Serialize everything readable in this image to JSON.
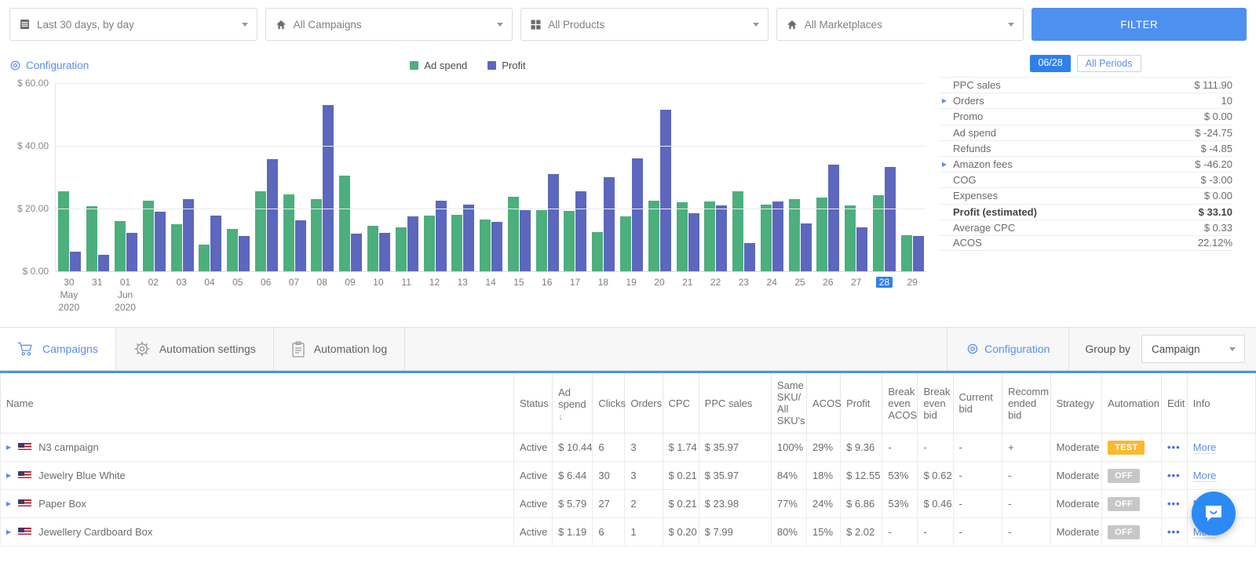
{
  "filters": {
    "date_range": {
      "label": "Last 30 days, by day",
      "icon": "calendar-icon"
    },
    "campaigns": {
      "label": "All Campaigns",
      "icon": "home-icon"
    },
    "products": {
      "label": "All Products",
      "icon": "grid-icon"
    },
    "marketplaces": {
      "label": "All Marketplaces",
      "icon": "home-icon"
    },
    "filter_button": "FILTER"
  },
  "chart_panel": {
    "configuration_label": "Configuration",
    "legend": [
      {
        "name": "Ad spend",
        "color": "#4caf7d"
      },
      {
        "name": "Profit",
        "color": "#5c67bd"
      }
    ]
  },
  "chart_data": {
    "type": "bar",
    "title": "",
    "xlabel": "",
    "ylabel": "",
    "ylim": [
      0,
      60
    ],
    "ytick_labels": [
      "$ 0.00",
      "$ 20.00",
      "$ 40.00",
      "$ 60.00"
    ],
    "yticks": [
      0,
      20,
      40,
      60
    ],
    "grid": true,
    "legend_position": "top-center",
    "selected_category": "28",
    "categories": [
      "30",
      "31",
      "01",
      "02",
      "03",
      "04",
      "05",
      "06",
      "07",
      "08",
      "09",
      "10",
      "11",
      "12",
      "13",
      "14",
      "15",
      "16",
      "17",
      "18",
      "19",
      "20",
      "21",
      "22",
      "23",
      "24",
      "25",
      "26",
      "27",
      "28",
      "29"
    ],
    "category_sublabels": [
      [
        "May",
        "2020"
      ],
      [],
      [
        "Jun",
        "2020"
      ],
      [],
      [],
      [],
      [],
      [],
      [],
      [],
      [],
      [],
      [],
      [],
      [],
      [],
      [],
      [],
      [],
      [],
      [],
      [],
      [],
      [],
      [],
      [],
      [],
      [],
      [],
      [],
      []
    ],
    "series": [
      {
        "name": "Ad spend",
        "color": "#4caf7d",
        "values": [
          25.5,
          20.8,
          16.0,
          22.5,
          15.0,
          8.5,
          13.5,
          25.5,
          24.5,
          23.0,
          30.5,
          14.5,
          14.0,
          17.8,
          18.0,
          16.6,
          23.8,
          19.5,
          19.2,
          12.5,
          17.4,
          22.5,
          22.0,
          22.3,
          25.5,
          21.2,
          23.0,
          23.5,
          21.0,
          24.3,
          11.6
        ]
      },
      {
        "name": "Profit",
        "color": "#5c67bd",
        "values": [
          6.2,
          5.2,
          12.3,
          19.0,
          23.0,
          17.8,
          11.3,
          35.8,
          16.2,
          53.0,
          12.0,
          12.3,
          17.4,
          22.5,
          21.3,
          15.8,
          19.5,
          31.0,
          25.5,
          30.0,
          36.0,
          51.5,
          18.6,
          21.0,
          9.0,
          22.2,
          15.2,
          34.0,
          14.0,
          33.2,
          11.2
        ]
      }
    ]
  },
  "stats_panel": {
    "tabs": [
      {
        "label": "06/28",
        "active": true
      },
      {
        "label": "All Periods",
        "active": false
      }
    ],
    "rows": [
      {
        "name": "PPC sales",
        "value": "$ 111.90",
        "expandable": false,
        "bold": false
      },
      {
        "name": "Orders",
        "value": "10",
        "expandable": true,
        "bold": false
      },
      {
        "name": "Promo",
        "value": "$ 0.00",
        "expandable": false,
        "bold": false
      },
      {
        "name": "Ad spend",
        "value": "$ -24.75",
        "expandable": false,
        "bold": false
      },
      {
        "name": "Refunds",
        "value": "$ -4.85",
        "expandable": false,
        "bold": false
      },
      {
        "name": "Amazon fees",
        "value": "$ -46.20",
        "expandable": true,
        "bold": false
      },
      {
        "name": "COG",
        "value": "$ -3.00",
        "expandable": false,
        "bold": false
      },
      {
        "name": "Expenses",
        "value": "$ 0.00",
        "expandable": false,
        "bold": false
      },
      {
        "name": "Profit (estimated)",
        "value": "$ 33.10",
        "expandable": false,
        "bold": true
      },
      {
        "name": "Average CPC",
        "value": "$ 0.33",
        "expandable": false,
        "bold": false
      },
      {
        "name": "ACOS",
        "value": "22.12%",
        "expandable": false,
        "bold": false
      }
    ]
  },
  "tabbar": {
    "tabs": [
      {
        "label": "Campaigns",
        "icon": "cart-icon",
        "active": true
      },
      {
        "label": "Automation settings",
        "icon": "gear-icon",
        "active": false
      },
      {
        "label": "Automation log",
        "icon": "clipboard-icon",
        "active": false
      }
    ],
    "configuration_label": "Configuration",
    "group_by_label": "Group by",
    "group_by_value": "Campaign"
  },
  "table": {
    "columns": [
      "Name",
      "Status",
      "Ad spend",
      "Clicks",
      "Orders",
      "CPC",
      "PPC sales",
      "Same SKU/ All SKU's",
      "ACOS",
      "Profit",
      "Break even ACOS",
      "Break even bid",
      "Current bid",
      "Recomm ended bid",
      "Strategy",
      "Automation",
      "Edit",
      "Info"
    ],
    "sorted_column": "Ad spend",
    "sort_direction": "desc",
    "rows": [
      {
        "name": "N3 campaign",
        "status": "Active",
        "ad_spend": "$ 10.44",
        "clicks": "6",
        "orders": "3",
        "cpc": "$ 1.74",
        "ppc_sales": "$ 35.97",
        "same_sku": "100%",
        "acos": "29%",
        "profit": "$ 9.36",
        "be_acos": "-",
        "be_bid": "-",
        "current_bid": "-",
        "recommended_bid": "+",
        "strategy": "Moderate",
        "automation": "TEST",
        "automation_state": "test",
        "edit": "•••",
        "info": "More"
      },
      {
        "name": "Jewelry Blue White",
        "status": "Active",
        "ad_spend": "$ 6.44",
        "clicks": "30",
        "orders": "3",
        "cpc": "$ 0.21",
        "ppc_sales": "$ 35.97",
        "same_sku": "84%",
        "acos": "18%",
        "profit": "$ 12.55",
        "be_acos": "53%",
        "be_bid": "$ 0.62",
        "current_bid": "-",
        "recommended_bid": "-",
        "strategy": "Moderate",
        "automation": "OFF",
        "automation_state": "off",
        "edit": "•••",
        "info": "More"
      },
      {
        "name": "Paper Box",
        "status": "Active",
        "ad_spend": "$ 5.79",
        "clicks": "27",
        "orders": "2",
        "cpc": "$ 0.21",
        "ppc_sales": "$ 23.98",
        "same_sku": "77%",
        "acos": "24%",
        "profit": "$ 6.86",
        "be_acos": "53%",
        "be_bid": "$ 0.46",
        "current_bid": "-",
        "recommended_bid": "-",
        "strategy": "Moderate",
        "automation": "OFF",
        "automation_state": "off",
        "edit": "•••",
        "info": "More"
      },
      {
        "name": "Jewellery Cardboard Box",
        "status": "Active",
        "ad_spend": "$ 1.19",
        "clicks": "6",
        "orders": "1",
        "cpc": "$ 0.20",
        "ppc_sales": "$ 7.99",
        "same_sku": "80%",
        "acos": "15%",
        "profit": "$ 2.02",
        "be_acos": "-",
        "be_bid": "-",
        "current_bid": "-",
        "recommended_bid": "-",
        "strategy": "Moderate",
        "automation": "OFF",
        "automation_state": "off",
        "edit": "•••",
        "info": "More"
      }
    ]
  },
  "chat": {
    "icon": "chat-bubble-icon"
  }
}
